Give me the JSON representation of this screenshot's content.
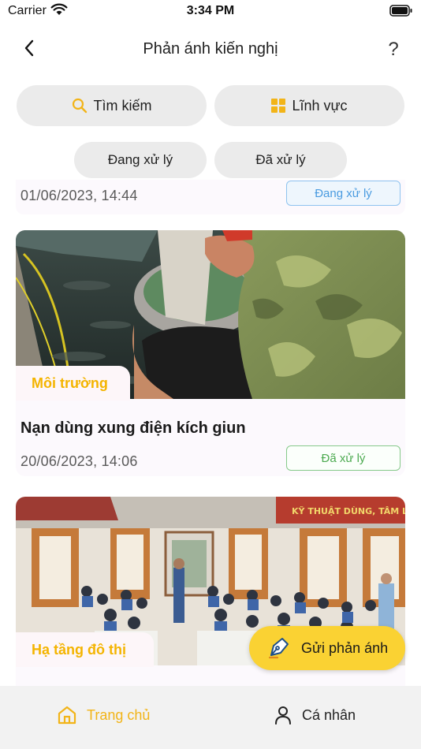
{
  "status": {
    "carrier": "Carrier",
    "time": "3:34 PM"
  },
  "nav": {
    "title": "Phản ánh kiến nghị",
    "help": "?"
  },
  "filters": {
    "search_label": "Tìm kiếm",
    "field_label": "Lĩnh vực",
    "processing_label": "Đang xử lý",
    "done_label": "Đã xử lý"
  },
  "feed": [
    {
      "date": "01/06/2023, 14:44",
      "status": "Đang xử lý"
    },
    {
      "category": "Môi trường",
      "title": "Nạn dùng xung điện kích giun",
      "date": "20/06/2023, 14:06",
      "status": "Đã xử lý"
    },
    {
      "category": "Hạ tầng đô thị",
      "banner_text": "KỸ THUẬT DÙNG, TÂM LÝ"
    }
  ],
  "fab": {
    "label": "Gửi phản ánh"
  },
  "tabs": {
    "home_label": "Trang chủ",
    "profile_label": "Cá nhân"
  },
  "colors": {
    "accent": "#f2b418",
    "fab": "#fad233",
    "processing": "#4a9be0",
    "done": "#4caa50"
  },
  "icons": [
    "wifi-icon",
    "battery-icon",
    "back-chevron-icon",
    "search-icon",
    "grid-icon",
    "pen-icon",
    "home-icon",
    "person-icon"
  ]
}
